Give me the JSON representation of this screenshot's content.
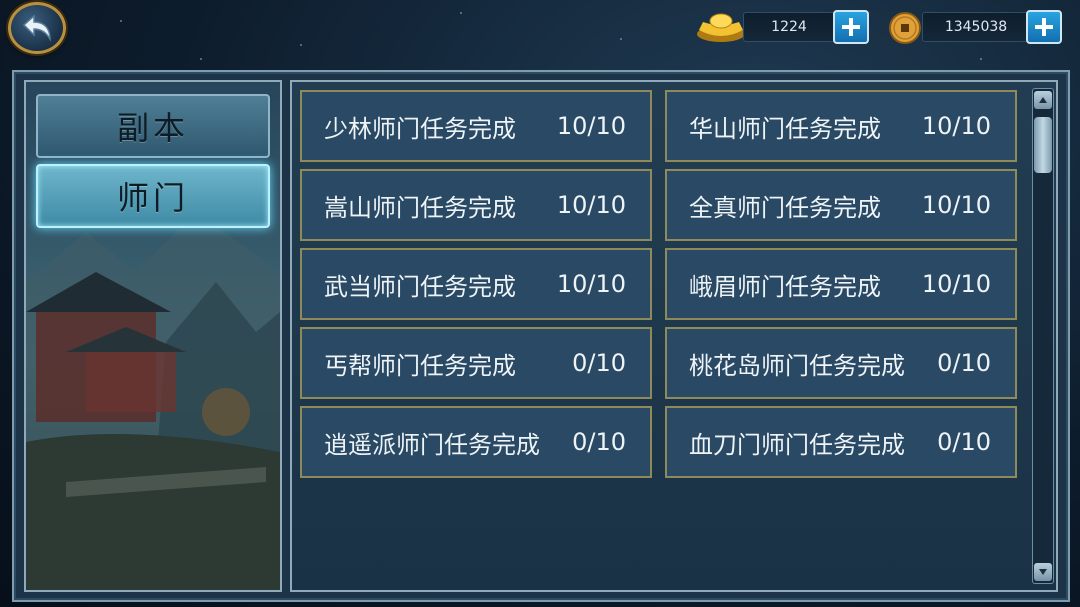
{
  "currencies": [
    {
      "name": "gold-ingot",
      "value": "1224"
    },
    {
      "name": "copper-coin",
      "value": "1345038"
    }
  ],
  "tabs": [
    {
      "label": "副本",
      "active": false
    },
    {
      "label": "师门",
      "active": true
    }
  ],
  "tasks": [
    {
      "name": "少林师门任务完成",
      "progress": "10/10"
    },
    {
      "name": "华山师门任务完成",
      "progress": "10/10"
    },
    {
      "name": "嵩山师门任务完成",
      "progress": "10/10"
    },
    {
      "name": "全真师门任务完成",
      "progress": "10/10"
    },
    {
      "name": "武当师门任务完成",
      "progress": "10/10"
    },
    {
      "name": "峨眉师门任务完成",
      "progress": "10/10"
    },
    {
      "name": "丐帮师门任务完成",
      "progress": "0/10"
    },
    {
      "name": "桃花岛师门任务完成",
      "progress": "0/10"
    },
    {
      "name": "逍遥派师门任务完成",
      "progress": "0/10"
    },
    {
      "name": "血刀门师门任务完成",
      "progress": "0/10"
    }
  ],
  "icons": {
    "back": "back-arrow-icon",
    "plus": "plus-icon",
    "gold": "gold-ingot-icon",
    "coin": "copper-coin-icon"
  },
  "colors": {
    "accent_blue": "#2aa3e0",
    "active_tab_glow": "#63d8ff",
    "task_border": "#8e8a5a"
  }
}
